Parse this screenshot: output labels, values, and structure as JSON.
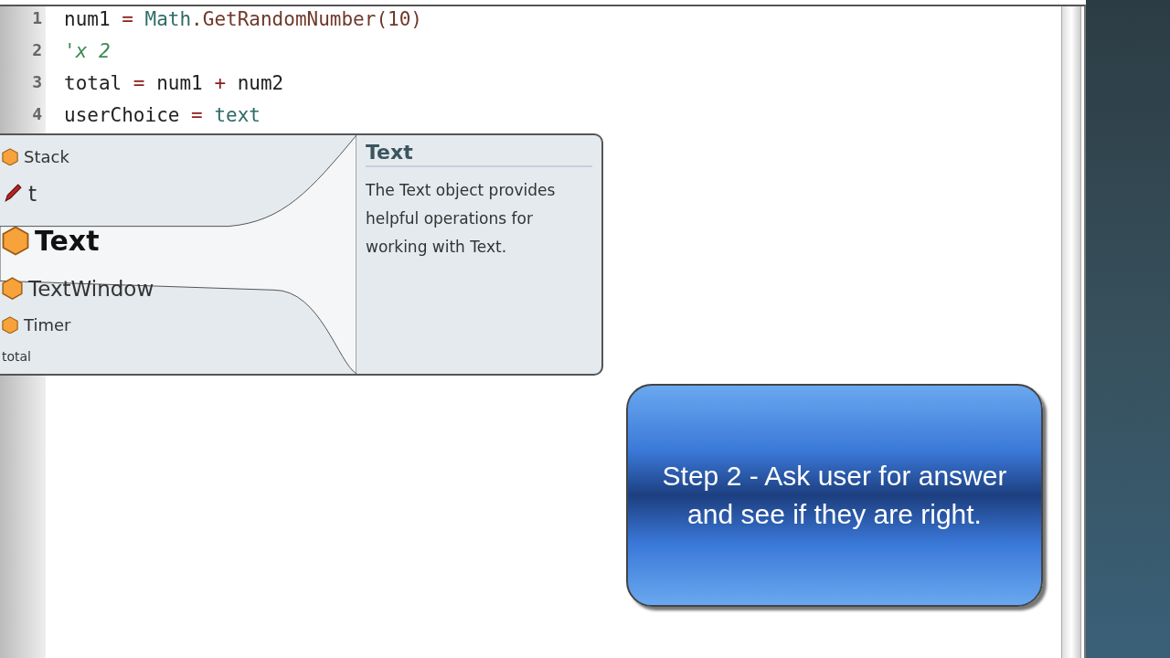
{
  "editor": {
    "lines": [
      {
        "number": "1",
        "tokens": [
          {
            "kind": "ident",
            "text": "num1"
          },
          {
            "kind": "op",
            "text": " = "
          },
          {
            "kind": "object",
            "text": "Math"
          },
          {
            "kind": "method",
            "text": ".GetRandomNumber(10)"
          }
        ]
      },
      {
        "number": "2",
        "tokens": [
          {
            "kind": "comment",
            "text": "'x 2"
          }
        ]
      },
      {
        "number": "3",
        "tokens": [
          {
            "kind": "ident",
            "text": "total"
          },
          {
            "kind": "op",
            "text": " = "
          },
          {
            "kind": "ident",
            "text": "num1"
          },
          {
            "kind": "op",
            "text": " + "
          },
          {
            "kind": "ident",
            "text": "num2"
          }
        ]
      },
      {
        "number": "4",
        "tokens": [
          {
            "kind": "ident",
            "text": "userChoice"
          },
          {
            "kind": "op",
            "text": " = "
          },
          {
            "kind": "object",
            "text": "text"
          }
        ]
      }
    ]
  },
  "intellisense": {
    "items": [
      {
        "kind": "object",
        "label": "Stack",
        "selected": false
      },
      {
        "kind": "variable",
        "label": "t",
        "selected": false
      },
      {
        "kind": "object",
        "label": "Text",
        "selected": true
      },
      {
        "kind": "object",
        "label": "TextWindow",
        "selected": false
      },
      {
        "kind": "object",
        "label": "Timer",
        "selected": false
      },
      {
        "kind": "none",
        "label": "total",
        "selected": false
      }
    ],
    "help": {
      "title": "Text",
      "description": "The Text object provides helpful operations for working with Text."
    }
  },
  "callout": {
    "text": "Step 2 - Ask user for answer and see if they are right."
  }
}
